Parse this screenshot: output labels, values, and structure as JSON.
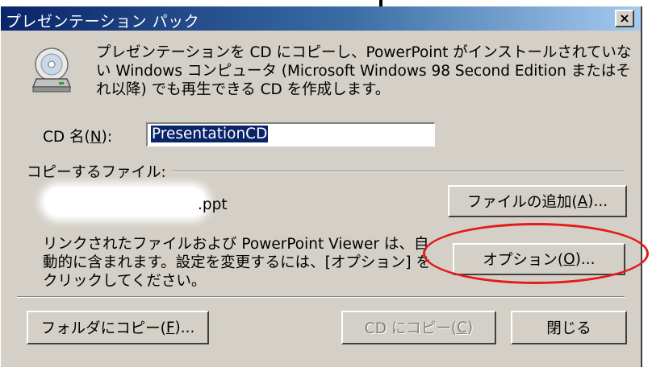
{
  "dialog": {
    "title": "プレゼンテーション パック",
    "close_label": "×",
    "description": "プレゼンテーションを CD にコピーし、PowerPoint がインストールされていない Windows コンピュータ (Microsoft Windows 98 Second Edition またはそれ以降) でも再生できる CD を作成します。",
    "icon": "cd-drive-icon"
  },
  "cd_name": {
    "label_prefix": "CD 名(",
    "label_key": "N",
    "label_suffix": "):",
    "value": "PresentationCD"
  },
  "files": {
    "group_label": "コピーするファイル:",
    "items": [
      {
        "name_suffix": ".ppt",
        "name_obscured": true
      }
    ],
    "add_button": {
      "prefix": "ファイルの追加(",
      "key": "A",
      "suffix": ")..."
    }
  },
  "linked_info": "リンクされたファイルおよび PowerPoint Viewer は、自動的に含まれます。設定を変更するには、[オプション] をクリックしてください。",
  "options_button": {
    "prefix": "オプション(",
    "key": "O",
    "suffix": ")..."
  },
  "footer": {
    "copy_folder_button": {
      "prefix": "フォルダにコピー(",
      "key": "F",
      "suffix": ")..."
    },
    "copy_cd_button": {
      "prefix": "CD にコピー(",
      "key": "C",
      "suffix": ")"
    },
    "close_button": "閉じる"
  },
  "colors": {
    "title_start": "#0a246a",
    "title_end": "#a6caf0",
    "face": "#d4d0c8",
    "selection": "#0a246a",
    "annotation": "#e21b1b"
  }
}
